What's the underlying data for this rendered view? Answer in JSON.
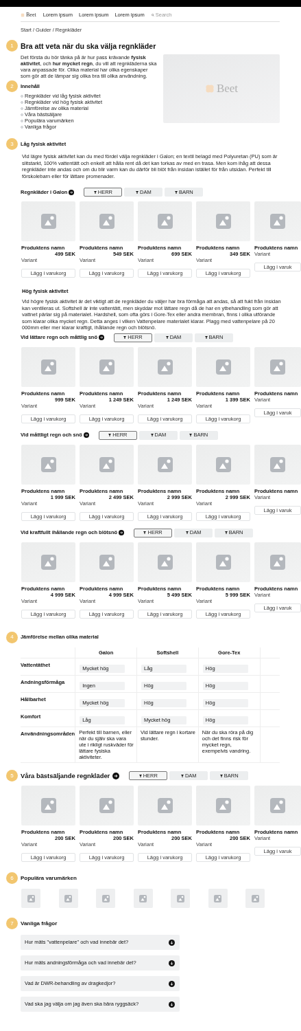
{
  "nav": {
    "logo": "Beet",
    "links": [
      "Lorem ipsum",
      "Lorem ipsum",
      "Lorem ipsum"
    ],
    "search": {
      "placeholder": "Search"
    }
  },
  "breadcrumb": "Start / Guider / Regnkläder",
  "sections": [
    {
      "kind": "intro",
      "number": "1",
      "heading": "Bra att veta när du ska välja regnkläder",
      "text": "Det första du bör tänka på är hur pass krävande **fysisk aktivitet**, och **hur mycket regn**, du vill att regnkläderna ska vara anpassade för. Olika material har olika egenskaper som gör att de lämpar sig olika bra till olika användning.",
      "hero_logo": "Beet",
      "toc": {
        "number": "2",
        "heading": "Innehåll",
        "items": [
          "Regnkläder vid låg fysisk aktivitet",
          "Regnkläder vid hög fysisk aktivitet",
          "Jämförelse av olika material",
          "Våra bästsäljare",
          "Populära varumärken",
          "Vanliga frågor"
        ]
      }
    },
    {
      "kind": "article",
      "number": "3",
      "heading": "Låg fysisk aktivitet",
      "text": "Vid lägre fysisk aktivitet kan du med fördel välja regnkläder i Galon; en textil belagd med Polyuretan (PU) som är slitstarkt, 100% vattentätt och enkelt att hålla rent då det kan torkas av med en trasa. Men kom ihåg att dessa regnkläder inte andas och om du blir varm kan du därför bli blöt från insidan istället för från utsidan. Perfekt till förskolebarn eller för lättare promenader.",
      "groups": [
        {
          "title": "Regnkläder i Galon",
          "filters": [
            {
              "label": "HERR",
              "selected": true
            },
            {
              "label": "DAM",
              "selected": false
            },
            {
              "label": "BARN",
              "selected": false
            }
          ],
          "products": [
            {
              "name": "Produktens namn",
              "price": "499 SEK",
              "variant": "Variant",
              "button": "Lägg i varukorg"
            },
            {
              "name": "Produktens namn",
              "price": "549 SEK",
              "variant": "Variant",
              "button": "Lägg i varukorg"
            },
            {
              "name": "Produktens namn",
              "price": "699 SEK",
              "variant": "Variant",
              "button": "Lägg i varukorg"
            },
            {
              "name": "Produktens namn",
              "price": "349 SEK",
              "variant": "Variant",
              "button": "Lägg i varukorg"
            },
            {
              "name": "Produktens namn",
              "variant": "Variant",
              "button": "Lägg i varuk"
            }
          ]
        }
      ]
    },
    {
      "kind": "article",
      "heading": "Hög fysisk aktivitet",
      "text": "Vid högre fysisk aktivitet är det viktigt att de regnkläder du väljer har bra förmåga att andas, så att fukt från insidan kan ventileras ut. Softshell är inte vattentätt, men skyddar mot lättare regn då de har en ytbehandling som gör att vattnet pärlar sig på materialet. Hardshell, som ofta görs i Gore-Tex eller andra membran, finns i olika utförande som klarar olika mycket regn. Detta anges i vilken Vattenpelare materialet klarar. Plagg med vattenpelare på 20 000mm eller mer klarar kraftigt, ihållande regn och blötsnö.",
      "groups": [
        {
          "title": "Vid lättare regn och måttlig snö",
          "filters": [
            {
              "label": "HERR",
              "selected": true
            },
            {
              "label": "DAM",
              "selected": false
            },
            {
              "label": "BARN",
              "selected": false
            }
          ],
          "products": [
            {
              "name": "Produktens namn",
              "price": "999 SEK",
              "variant": "Variant",
              "button": "Lägg i varukorg"
            },
            {
              "name": "Produktens namn",
              "price": "1 249 SEK",
              "variant": "Variant",
              "button": "Lägg i varukorg"
            },
            {
              "name": "Produktens namn",
              "price": "1 249 SEK",
              "variant": "Variant",
              "button": "Lägg i varukorg"
            },
            {
              "name": "Produktens namn",
              "price": "1 399 SEK",
              "variant": "Variant",
              "button": "Lägg i varukorg"
            },
            {
              "name": "Produktens namn",
              "variant": "Variant",
              "button": "Lägg i varuk"
            }
          ]
        },
        {
          "title": "Vid måttligt regn och snö",
          "filters": [
            {
              "label": "HERR",
              "selected": true
            },
            {
              "label": "DAM",
              "selected": false
            },
            {
              "label": "BARN",
              "selected": false
            }
          ],
          "products": [
            {
              "name": "Produktens namn",
              "price": "1 999 SEK",
              "variant": "Variant",
              "button": "Lägg i varukorg"
            },
            {
              "name": "Produktens namn",
              "price": "2 499 SEK",
              "variant": "Variant",
              "button": "Lägg i varukorg"
            },
            {
              "name": "Produktens namn",
              "price": "2 999 SEK",
              "variant": "Variant",
              "button": "Lägg i varukorg"
            },
            {
              "name": "Produktens namn",
              "price": "2 999 SEK",
              "variant": "Variant",
              "button": "Lägg i varukorg"
            },
            {
              "name": "Produktens namn",
              "variant": "Variant",
              "button": "Lägg i varuk"
            }
          ]
        },
        {
          "title": "Vid kraftfullt ihållande regn och blötsnö",
          "filters": [
            {
              "label": "HERR",
              "selected": true
            },
            {
              "label": "DAM",
              "selected": false
            },
            {
              "label": "BARN",
              "selected": false
            }
          ],
          "products": [
            {
              "name": "Produktens namn",
              "price": "4 999 SEK",
              "variant": "Variant",
              "button": "Lägg i varukorg"
            },
            {
              "name": "Produktens namn",
              "price": "4 999 SEK",
              "variant": "Variant",
              "button": "Lägg i varukorg"
            },
            {
              "name": "Produktens namn",
              "price": "5 499 SEK",
              "variant": "Variant",
              "button": "Lägg i varukorg"
            },
            {
              "name": "Produktens namn",
              "price": "5 999 SEK",
              "variant": "Variant",
              "button": "Lägg i varukorg"
            },
            {
              "name": "Produktens namn",
              "variant": "Variant",
              "button": "Lägg i varuk"
            }
          ]
        }
      ]
    },
    {
      "kind": "comparison",
      "number": "4",
      "heading": "Jämförelse mellan olika material",
      "columns": [
        "Galon",
        "Softshell",
        "Gore-Tex"
      ],
      "rows": [
        {
          "label": "Vattentäthet",
          "kind": "rating",
          "values": [
            "Mycket hög",
            "Låg",
            "Hög"
          ]
        },
        {
          "label": "Andningsförmåga",
          "kind": "rating",
          "values": [
            "Ingen",
            "Hög",
            "Hög"
          ]
        },
        {
          "label": "Hållbarhet",
          "kind": "rating",
          "values": [
            "Mycket hög",
            "Hög",
            "Hög"
          ]
        },
        {
          "label": "Komfort",
          "kind": "rating",
          "values": [
            "Låg",
            "Mycket hög",
            "Hög"
          ]
        },
        {
          "label": "Användningsområden",
          "kind": "note",
          "values": [
            "Perfekt till barnen, eller när du själv ska vara ute i rikligt ruskväder för lättare fysiska aktiviteter.",
            "Vid lättare regn i kortare stunder.",
            "När du ska röra på dig och det finns risk för mycket regn, exempelvis vandring."
          ]
        }
      ]
    },
    {
      "kind": "bestsellers",
      "number": "5",
      "heading": "Våra bästsäljande regnkläder",
      "filters": [
        {
          "label": "HERR",
          "selected": true
        },
        {
          "label": "DAM",
          "selected": false
        },
        {
          "label": "BARN",
          "selected": false
        }
      ],
      "products": [
        {
          "name": "Produktens namn",
          "price": "200 SEK",
          "variant": "Variant",
          "button": "Lägg i varukorg"
        },
        {
          "name": "Produktens namn",
          "price": "200 SEK",
          "variant": "Variant",
          "button": "Lägg i varukorg"
        },
        {
          "name": "Produktens namn",
          "price": "200 SEK",
          "variant": "Variant",
          "button": "Lägg i varukorg"
        },
        {
          "name": "Produktens namn",
          "price": "200 SEK",
          "variant": "Variant",
          "button": "Lägg i varukorg"
        },
        {
          "name": "Produktens namn",
          "variant": "Variant",
          "button": "Lägg i varuk"
        }
      ]
    },
    {
      "kind": "brands",
      "number": "6",
      "heading": "Populära varumärken"
    },
    {
      "kind": "faq",
      "number": "7",
      "heading": "Vanliga frågor",
      "questions": [
        {
          "text": "Hur mäts \"vattenpelare\" och vad innebär det?",
          "expanded": false
        },
        {
          "text": "Hur mäts andningsförmåga och vad innebär det?",
          "expanded": false
        },
        {
          "text": "Vad är DWR-behandling av dragkedjor?",
          "expanded": false
        },
        {
          "text": "Vad ska jag välja om jag även ska bära ryggsäck?",
          "expanded": false
        }
      ]
    }
  ]
}
